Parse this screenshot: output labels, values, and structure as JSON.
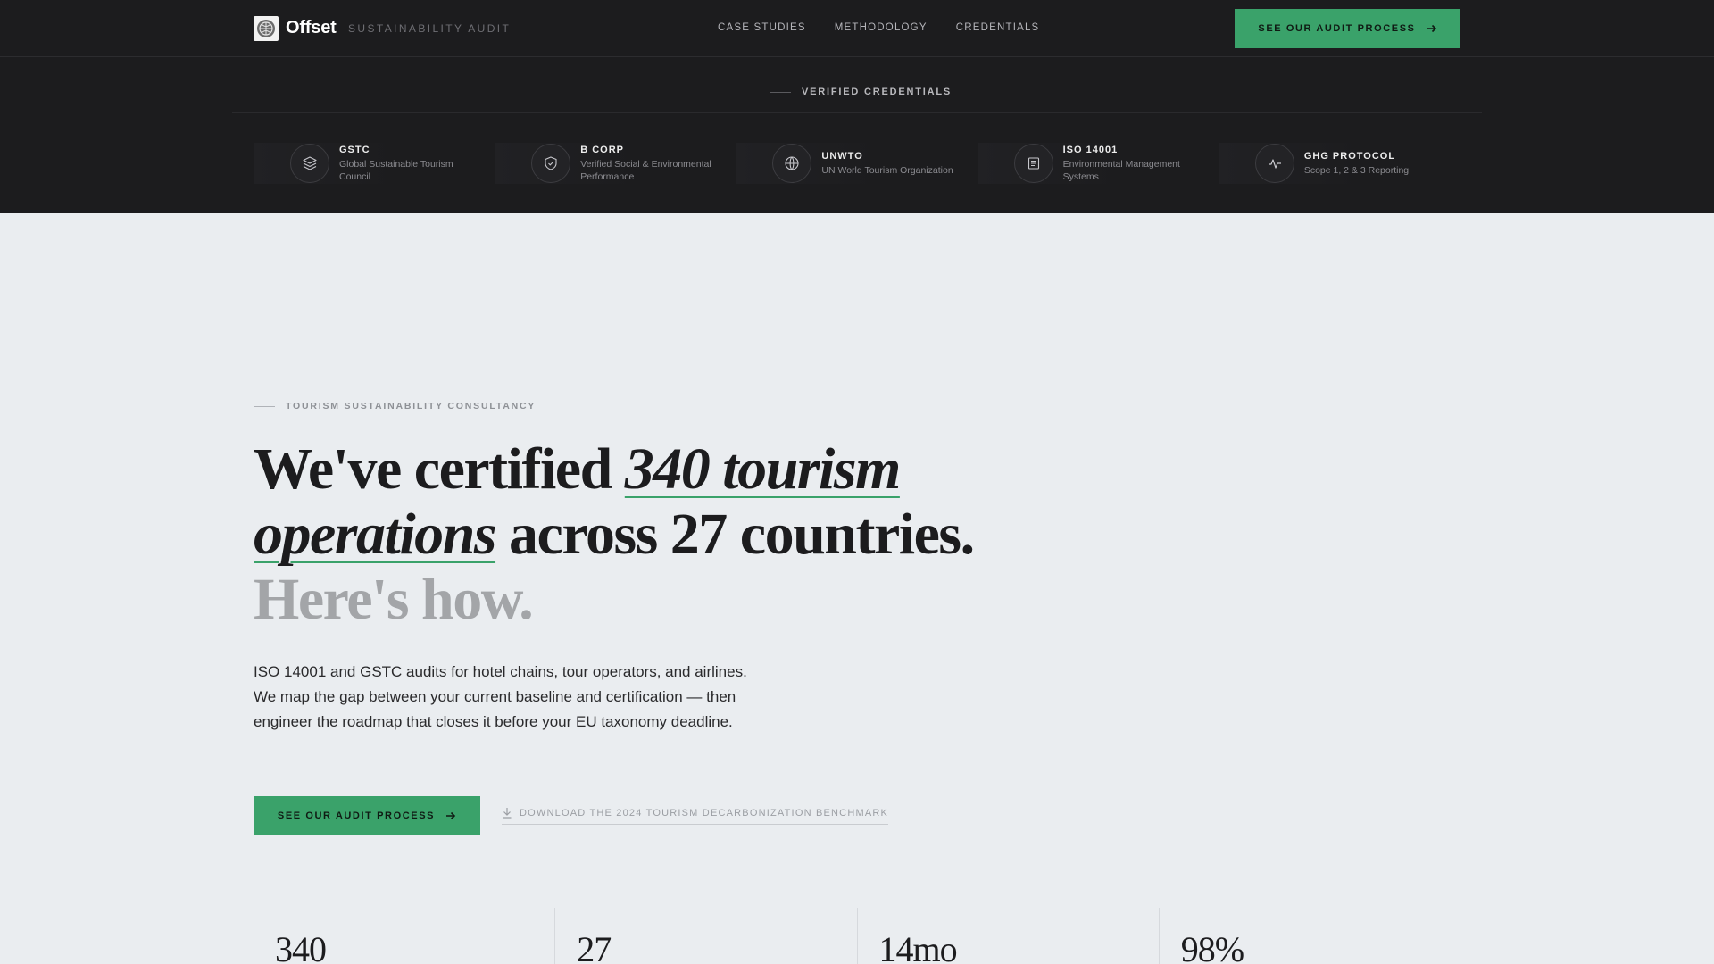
{
  "nav": {
    "brand": "Offset",
    "brand_sub": "SUSTAINABILITY AUDIT",
    "links": [
      "CASE STUDIES",
      "METHODOLOGY",
      "CREDENTIALS"
    ],
    "cta": "SEE OUR AUDIT PROCESS"
  },
  "credentials": {
    "heading": "VERIFIED CREDENTIALS",
    "items": [
      {
        "title": "GSTC",
        "desc": "Global Sustainable Tourism Council",
        "icon": "layers-icon"
      },
      {
        "title": "B CORP",
        "desc": "Verified Social & Environmental Performance",
        "icon": "shield-check-icon"
      },
      {
        "title": "UNWTO",
        "desc": "UN World Tourism Organization",
        "icon": "globe-icon"
      },
      {
        "title": "ISO 14001",
        "desc": "Environmental Management Systems",
        "icon": "document-icon"
      },
      {
        "title": "GHG PROTOCOL",
        "desc": "Scope 1, 2 & 3 Reporting",
        "icon": "activity-icon"
      }
    ]
  },
  "hero": {
    "eyebrow": "TOURISM SUSTAINABILITY CONSULTANCY",
    "headline_pre": "We've certified ",
    "headline_em": "340 tourism operations",
    "headline_post": " across 27 countries.",
    "headline_muted": "Here's how.",
    "lede": "ISO 14001 and GSTC audits for hotel chains, tour operators, and airlines. We map the gap between your current baseline and certification — then engineer the roadmap that closes it before your EU taxonomy deadline.",
    "cta": "SEE OUR AUDIT PROCESS",
    "download": "DOWNLOAD THE 2024 TOURISM DECARBONIZATION BENCHMARK"
  },
  "stats": [
    "340",
    "27",
    "14mo",
    "98%"
  ],
  "colors": {
    "accent": "#3aa26a",
    "dark_bg": "#1c1c1e",
    "page_bg": "#eaedf0"
  }
}
